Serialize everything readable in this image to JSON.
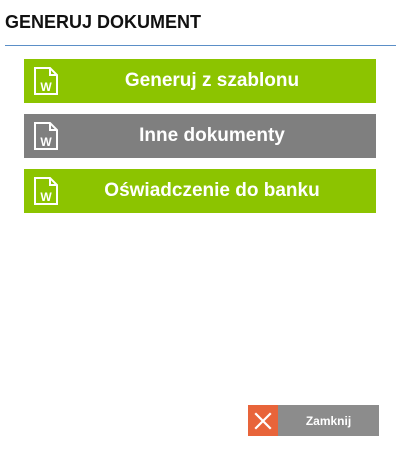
{
  "dialog": {
    "title": "GENERUJ DOKUMENT"
  },
  "buttons": [
    {
      "label": "Generuj z szablonu",
      "icon": "word-document-icon",
      "color": "#8cc400"
    },
    {
      "label": "Inne dokumenty",
      "icon": "word-document-icon",
      "color": "#7f7f7f"
    },
    {
      "label": "Oświadczenie do banku",
      "icon": "word-document-icon",
      "color": "#8cc400"
    }
  ],
  "footer": {
    "close_label": "Zamknij",
    "close_icon": "close-icon",
    "close_icon_color": "#e8643a"
  },
  "colors": {
    "accent_green": "#8cc400",
    "neutral_gray": "#7f7f7f",
    "rule_blue": "#5b8fc7"
  }
}
